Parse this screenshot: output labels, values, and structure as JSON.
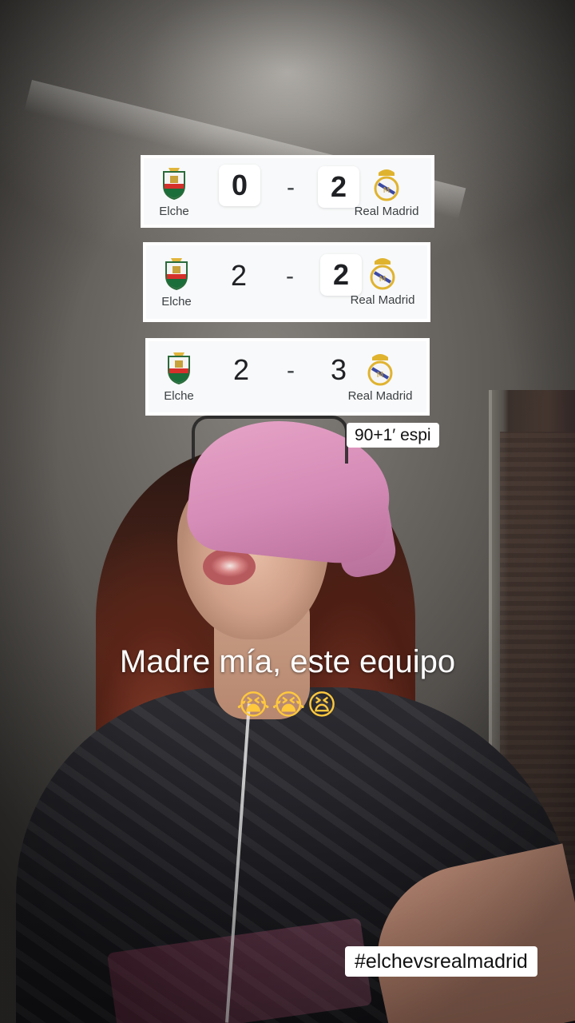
{
  "scoreboards": [
    {
      "home": {
        "name": "Elche",
        "score": "0",
        "highlight": true
      },
      "away": {
        "name": "Real Madrid",
        "score": "2",
        "highlight": true
      },
      "separator": "-"
    },
    {
      "home": {
        "name": "Elche",
        "score": "2",
        "highlight": false
      },
      "away": {
        "name": "Real Madrid",
        "score": "2",
        "highlight": true
      },
      "separator": "-"
    },
    {
      "home": {
        "name": "Elche",
        "score": "2",
        "highlight": false
      },
      "away": {
        "name": "Real Madrid",
        "score": "3",
        "highlight": false
      },
      "separator": "-"
    }
  ],
  "minute_tag": "90+1′ espi",
  "caption": "Madre mía, este equipo",
  "emojis": "😭😭😫",
  "hashtag": "#elchevsrealmadrid",
  "colors": {
    "bandana": "#d58cb7",
    "card_bg": "#f8f9fa",
    "caption_text": "#ffffff"
  }
}
